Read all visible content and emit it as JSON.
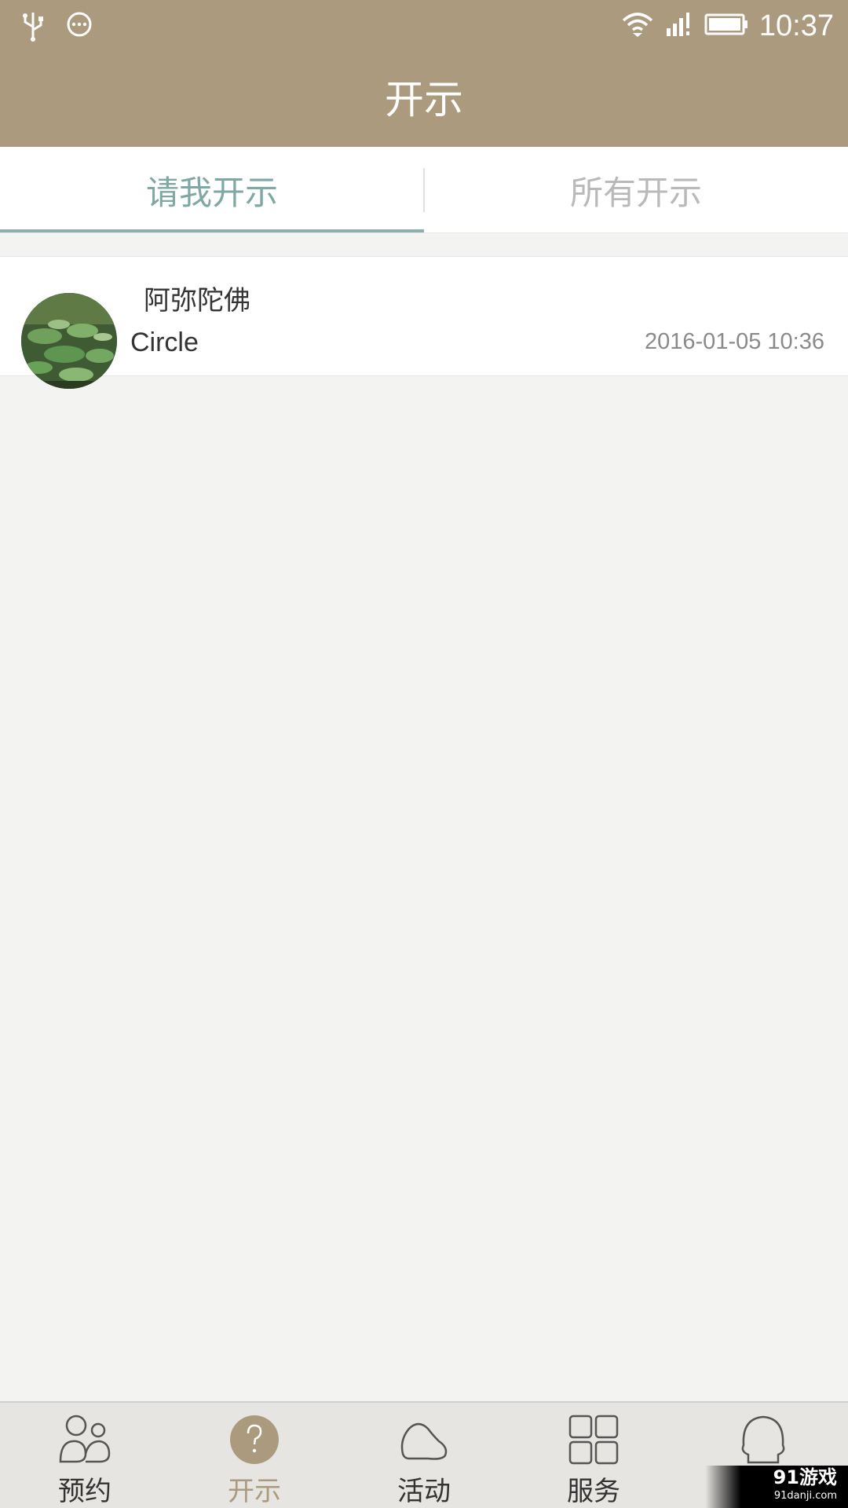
{
  "status_bar": {
    "time": "10:37",
    "icons": [
      "usb-icon",
      "more-icon",
      "wifi-icon",
      "signal-icon",
      "battery-icon"
    ]
  },
  "header": {
    "title": "开示"
  },
  "tabs": [
    {
      "label": "请我开示",
      "active": true
    },
    {
      "label": "所有开示",
      "active": false
    }
  ],
  "list": [
    {
      "title": "阿弥陀佛",
      "subtitle": "Circle",
      "time": "2016-01-05 10:36",
      "avatar": "lotus-pond-image"
    }
  ],
  "bottom_nav": [
    {
      "label": "预约",
      "icon": "people-icon",
      "active": false
    },
    {
      "label": "开示",
      "icon": "question-icon",
      "active": true
    },
    {
      "label": "活动",
      "icon": "stone-icon",
      "active": false
    },
    {
      "label": "服务",
      "icon": "grid-icon",
      "active": false
    },
    {
      "label": "",
      "icon": "bell-icon",
      "active": false
    }
  ],
  "watermark": {
    "brand": "91游戏",
    "url": "91danji.com"
  },
  "colors": {
    "header_bg": "#ab9a7d",
    "tab_active": "#7ea8a3",
    "tab_inactive": "#b9b9b9",
    "nav_active": "#ab9a7d",
    "background": "#f3f3f1"
  }
}
